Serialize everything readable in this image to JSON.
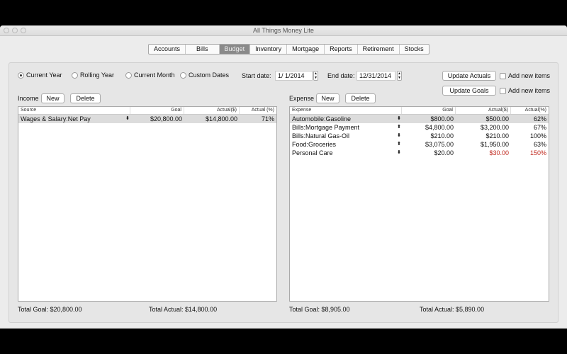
{
  "window": {
    "title": "All Things Money Lite"
  },
  "tabs": [
    {
      "label": "Accounts"
    },
    {
      "label": "Bills"
    },
    {
      "label": "Budget",
      "selected": true
    },
    {
      "label": "Inventory"
    },
    {
      "label": "Mortgage"
    },
    {
      "label": "Reports"
    },
    {
      "label": "Retirement"
    },
    {
      "label": "Stocks"
    }
  ],
  "period": {
    "options": [
      {
        "label": "Current Year",
        "checked": true
      },
      {
        "label": "Rolling Year"
      },
      {
        "label": "Current Month"
      },
      {
        "label": "Custom Dates"
      }
    ],
    "start_label": "Start date:",
    "start_value": "1/ 1/2014",
    "end_label": "End date:",
    "end_value": "12/31/2014"
  },
  "actions": {
    "update_actuals": "Update Actuals",
    "update_goals": "Update Goals",
    "add_new_items": "Add new items"
  },
  "income": {
    "label": "Income",
    "new": "New",
    "delete": "Delete",
    "columns": [
      "Source",
      "Goal",
      "Actual($)",
      "Actual (%)"
    ],
    "rows": [
      {
        "name": "Wages & Salary:Net Pay",
        "goal": "$20,800.00",
        "actual": "$14,800.00",
        "pct": "71%"
      }
    ],
    "total_goal": "Total Goal:  $20,800.00",
    "total_actual": "Total Actual:  $14,800.00"
  },
  "expense": {
    "label": "Expense",
    "new": "New",
    "delete": "Delete",
    "columns": [
      "Expense",
      "Goal",
      "Actual($)",
      "Actual(%)"
    ],
    "rows": [
      {
        "name": "Automobile:Gasoline",
        "goal": "$800.00",
        "actual": "$500.00",
        "pct": "62%"
      },
      {
        "name": "Bills:Mortgage Payment",
        "goal": "$4,800.00",
        "actual": "$3,200.00",
        "pct": "67%"
      },
      {
        "name": "Bills:Natural Gas-Oil",
        "goal": "$210.00",
        "actual": "$210.00",
        "pct": "100%"
      },
      {
        "name": "Food:Groceries",
        "goal": "$3,075.00",
        "actual": "$1,950.00",
        "pct": "63%"
      },
      {
        "name": "Personal Care",
        "goal": "$20.00",
        "actual": "$30.00",
        "pct": "150%",
        "over": true
      }
    ],
    "total_goal": "Total Goal:  $8,905.00",
    "total_actual": "Total Actual:  $5,890.00"
  },
  "colors": {
    "over_budget": "#c0281e",
    "selected_tab": "#8a8a8a"
  }
}
